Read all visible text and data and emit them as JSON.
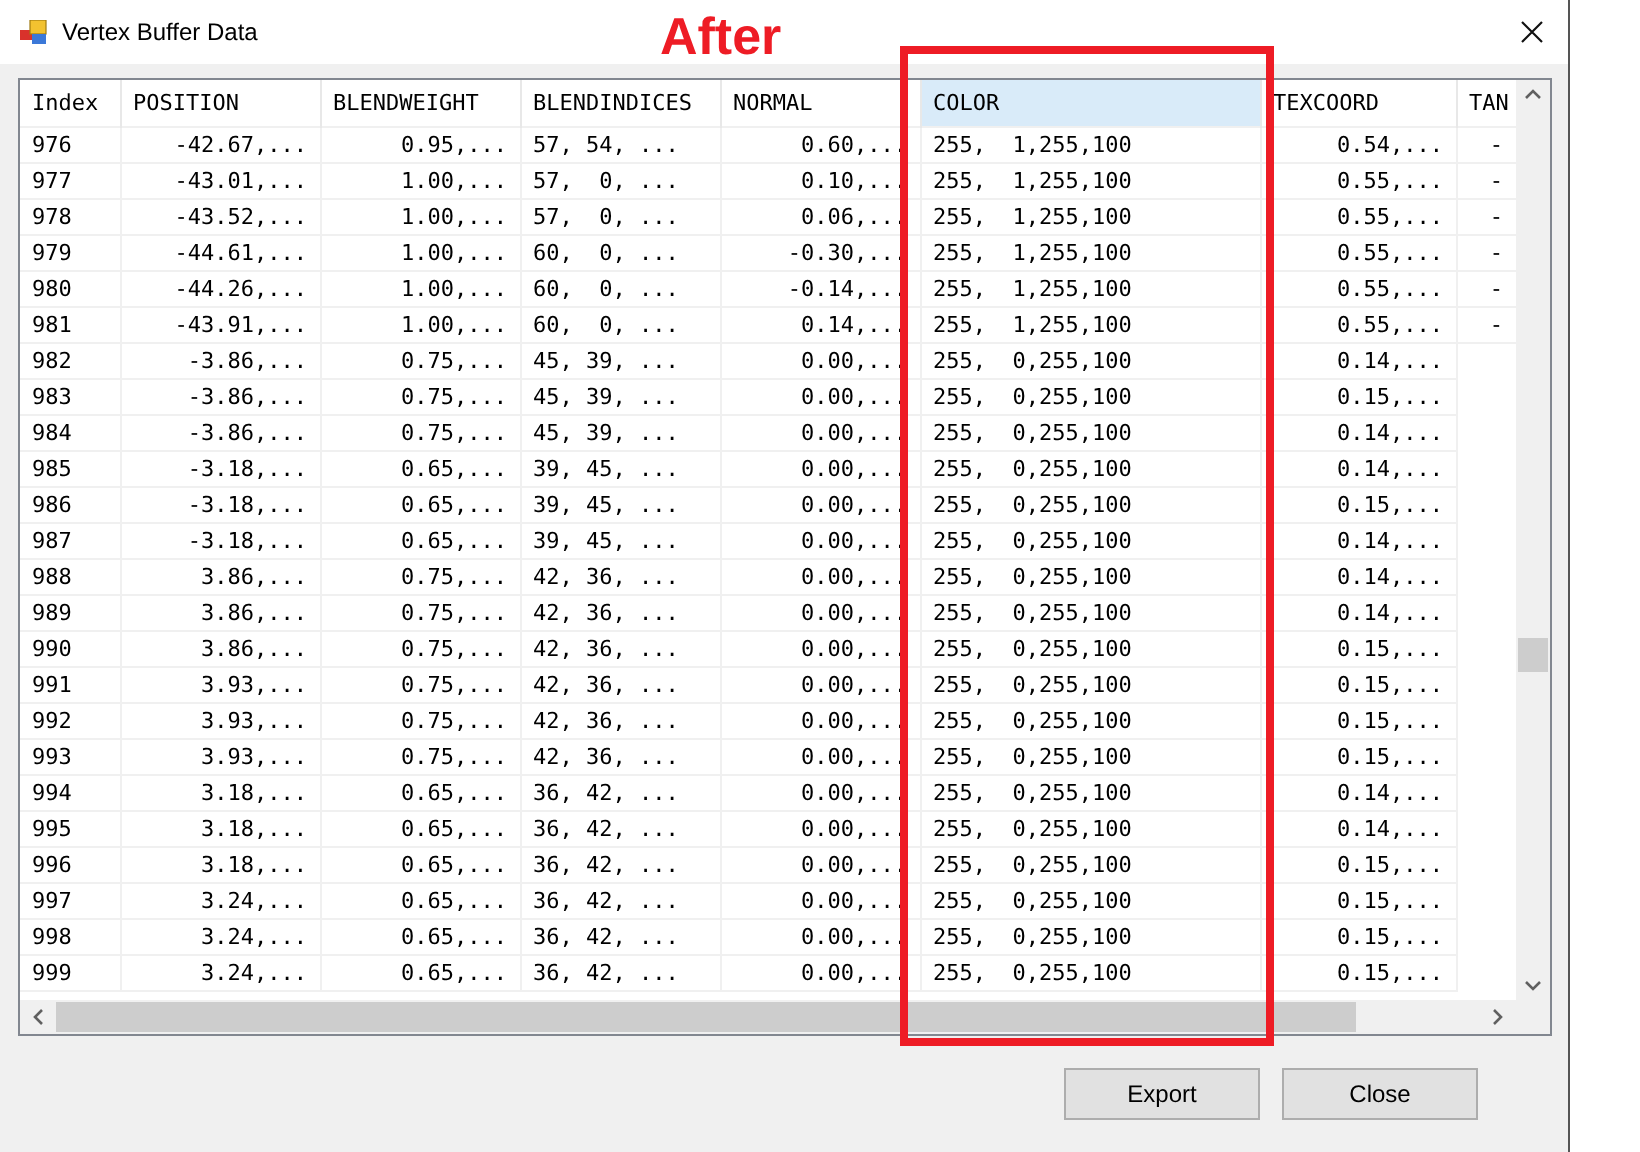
{
  "window": {
    "title": "Vertex Buffer Data"
  },
  "annotation": {
    "label": "After"
  },
  "table": {
    "columns": [
      {
        "label": "Index",
        "kind": "text",
        "selected": false
      },
      {
        "label": "POSITION",
        "kind": "number",
        "selected": false
      },
      {
        "label": "BLENDWEIGHT",
        "kind": "number",
        "selected": false
      },
      {
        "label": "BLENDINDICES",
        "kind": "text",
        "selected": false
      },
      {
        "label": "NORMAL",
        "kind": "number",
        "selected": false
      },
      {
        "label": "COLOR",
        "kind": "text",
        "selected": true
      },
      {
        "label": "TEXCOORD",
        "kind": "number",
        "selected": false
      },
      {
        "label": "TAN",
        "kind": "number",
        "selected": false
      }
    ],
    "rows": [
      [
        "976",
        "-42.67,...",
        "0.95,...",
        "57, 54, ...",
        "0.60,...",
        "255,  1,255,100",
        "0.54,...",
        "-"
      ],
      [
        "977",
        "-43.01,...",
        "1.00,...",
        "57,  0, ...",
        "0.10,...",
        "255,  1,255,100",
        "0.55,...",
        "-"
      ],
      [
        "978",
        "-43.52,...",
        "1.00,...",
        "57,  0, ...",
        "0.06,...",
        "255,  1,255,100",
        "0.55,...",
        "-"
      ],
      [
        "979",
        "-44.61,...",
        "1.00,...",
        "60,  0, ...",
        "-0.30,...",
        "255,  1,255,100",
        "0.55,...",
        "-"
      ],
      [
        "980",
        "-44.26,...",
        "1.00,...",
        "60,  0, ...",
        "-0.14,...",
        "255,  1,255,100",
        "0.55,...",
        "-"
      ],
      [
        "981",
        "-43.91,...",
        "1.00,...",
        "60,  0, ...",
        "0.14,...",
        "255,  1,255,100",
        "0.55,...",
        "-"
      ],
      [
        "982",
        "-3.86,...",
        "0.75,...",
        "45, 39, ...",
        "0.00,...",
        "255,  0,255,100",
        "0.14,..."
      ],
      [
        "983",
        "-3.86,...",
        "0.75,...",
        "45, 39, ...",
        "0.00,...",
        "255,  0,255,100",
        "0.15,..."
      ],
      [
        "984",
        "-3.86,...",
        "0.75,...",
        "45, 39, ...",
        "0.00,...",
        "255,  0,255,100",
        "0.14,..."
      ],
      [
        "985",
        "-3.18,...",
        "0.65,...",
        "39, 45, ...",
        "0.00,...",
        "255,  0,255,100",
        "0.14,..."
      ],
      [
        "986",
        "-3.18,...",
        "0.65,...",
        "39, 45, ...",
        "0.00,...",
        "255,  0,255,100",
        "0.15,..."
      ],
      [
        "987",
        "-3.18,...",
        "0.65,...",
        "39, 45, ...",
        "0.00,...",
        "255,  0,255,100",
        "0.14,..."
      ],
      [
        "988",
        "3.86,...",
        "0.75,...",
        "42, 36, ...",
        "0.00,...",
        "255,  0,255,100",
        "0.14,..."
      ],
      [
        "989",
        "3.86,...",
        "0.75,...",
        "42, 36, ...",
        "0.00,...",
        "255,  0,255,100",
        "0.14,..."
      ],
      [
        "990",
        "3.86,...",
        "0.75,...",
        "42, 36, ...",
        "0.00,...",
        "255,  0,255,100",
        "0.15,..."
      ],
      [
        "991",
        "3.93,...",
        "0.75,...",
        "42, 36, ...",
        "0.00,...",
        "255,  0,255,100",
        "0.15,..."
      ],
      [
        "992",
        "3.93,...",
        "0.75,...",
        "42, 36, ...",
        "0.00,...",
        "255,  0,255,100",
        "0.15,..."
      ],
      [
        "993",
        "3.93,...",
        "0.75,...",
        "42, 36, ...",
        "0.00,...",
        "255,  0,255,100",
        "0.15,..."
      ],
      [
        "994",
        "3.18,...",
        "0.65,...",
        "36, 42, ...",
        "0.00,...",
        "255,  0,255,100",
        "0.14,..."
      ],
      [
        "995",
        "3.18,...",
        "0.65,...",
        "36, 42, ...",
        "0.00,...",
        "255,  0,255,100",
        "0.14,..."
      ],
      [
        "996",
        "3.18,...",
        "0.65,...",
        "36, 42, ...",
        "0.00,...",
        "255,  0,255,100",
        "0.15,..."
      ],
      [
        "997",
        "3.24,...",
        "0.65,...",
        "36, 42, ...",
        "0.00,...",
        "255,  0,255,100",
        "0.15,..."
      ],
      [
        "998",
        "3.24,...",
        "0.65,...",
        "36, 42, ...",
        "0.00,...",
        "255,  0,255,100",
        "0.15,..."
      ],
      [
        "999",
        "3.24,...",
        "0.65,...",
        "36, 42, ...",
        "0.00,...",
        "255,  0,255,100",
        "0.15,..."
      ]
    ]
  },
  "buttons": [
    {
      "label": "Export"
    },
    {
      "label": "Close"
    }
  ]
}
